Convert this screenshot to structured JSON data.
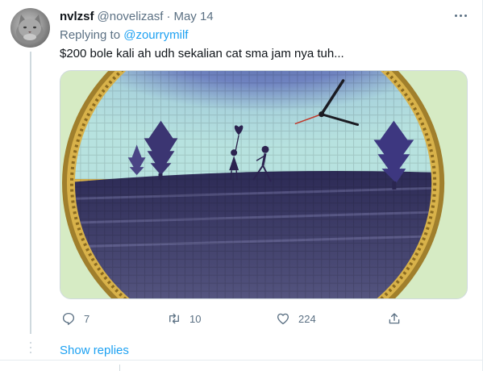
{
  "tweet": {
    "display_name": "nvlzsf",
    "handle": "@novelizasf",
    "separator": "·",
    "date": "May 14",
    "replying_prefix": "Replying to",
    "replying_to": "@zourrymilf",
    "text": "$200 bole kali ah udh sekalian cat sma jam nya tuh...",
    "media_icon": "painted-woven-clock-photo"
  },
  "actions": {
    "reply_count": "7",
    "retweet_count": "10",
    "like_count": "224"
  },
  "thread": {
    "show_replies_label": "Show replies"
  },
  "colors": {
    "accent": "#1da1f2",
    "secondary_text": "#5b7083",
    "primary_text": "#0f1419",
    "border": "#e6ecf0"
  }
}
